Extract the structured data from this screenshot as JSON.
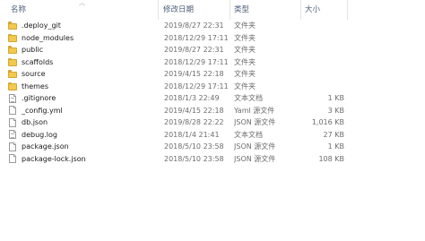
{
  "columns": {
    "name": "名称",
    "date": "修改日期",
    "type": "类型",
    "size": "大小"
  },
  "files": [
    {
      "name": ".deploy_git",
      "date": "2019/8/27 22:31",
      "type": "文件夹",
      "size": "",
      "icon": "folder-icon"
    },
    {
      "name": "node_modules",
      "date": "2018/12/29 17:11",
      "type": "文件夹",
      "size": "",
      "icon": "folder-icon"
    },
    {
      "name": "public",
      "date": "2019/8/27 22:31",
      "type": "文件夹",
      "size": "",
      "icon": "folder-icon"
    },
    {
      "name": "scaffolds",
      "date": "2018/12/29 17:11",
      "type": "文件夹",
      "size": "",
      "icon": "folder-icon"
    },
    {
      "name": "source",
      "date": "2019/4/15 22:18",
      "type": "文件夹",
      "size": "",
      "icon": "folder-icon"
    },
    {
      "name": "themes",
      "date": "2018/12/29 17:11",
      "type": "文件夹",
      "size": "",
      "icon": "folder-icon"
    },
    {
      "name": ".gitignore",
      "date": "2018/1/3 22:49",
      "type": "文本文档",
      "size": "1 KB",
      "icon": "text-file-icon"
    },
    {
      "name": "_config.yml",
      "date": "2019/4/15 22:18",
      "type": "Yaml 源文件",
      "size": "3 KB",
      "icon": "file-icon"
    },
    {
      "name": "db.json",
      "date": "2019/8/28 22:22",
      "type": "JSON 源文件",
      "size": "1,016 KB",
      "icon": "file-icon"
    },
    {
      "name": "debug.log",
      "date": "2018/1/4 21:41",
      "type": "文本文档",
      "size": "27 KB",
      "icon": "text-file-icon"
    },
    {
      "name": "package.json",
      "date": "2018/5/10 23:58",
      "type": "JSON 源文件",
      "size": "1 KB",
      "icon": "file-icon"
    },
    {
      "name": "package-lock.json",
      "date": "2018/5/10 23:58",
      "type": "JSON 源文件",
      "size": "108 KB",
      "icon": "file-icon"
    }
  ]
}
